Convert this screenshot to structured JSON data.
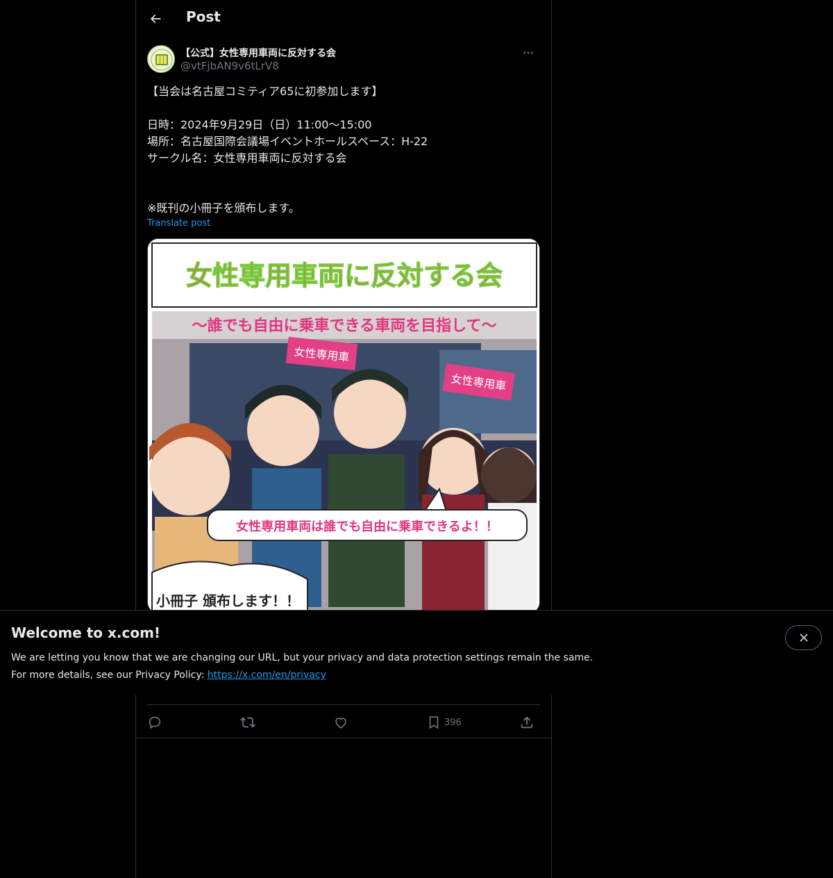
{
  "header": {
    "title": "Post",
    "back_icon": "arrow-left-icon"
  },
  "post": {
    "display_name": "【公式】女性専用車両に反対する会",
    "handle": "@vtFjbAN9v6tLrV8",
    "lines": [
      "【当会は名古屋コミティア65に初参加します】",
      "",
      "日時：2024年9月29日（日）11:00〜15:00",
      "場所：名古屋国際会議場イベントホールスペース：H-22",
      "サークル名：女性専用車両に反対する会",
      "",
      "",
      "※既刊の小冊子を頒布します。"
    ],
    "translate_label": "Translate post",
    "media": {
      "title": "女性専用車両に反対する会",
      "subtitle": "〜誰でも自由に乗車できる車両を目指して〜",
      "sign_1": "女性専用車",
      "sign_2": "女性専用車",
      "speech": "女性専用車両は誰でも自由に乗車できるよ！！",
      "footer": "小冊子 頒布します！！"
    }
  },
  "actions": {
    "reply_icon": "reply-icon",
    "repost_icon": "repost-icon",
    "like_icon": "heart-icon",
    "bookmark_icon": "bookmark-icon",
    "bookmark_count": "396",
    "share_icon": "share-icon"
  },
  "banner": {
    "title": "Welcome to x.com!",
    "line1": "We are letting you know that we are changing our URL, but your privacy and data protection settings remain the same.",
    "line2_prefix": "For more details, see our Privacy Policy: ",
    "link": "https://x.com/en/privacy"
  },
  "colors": {
    "background": "#000000",
    "text": "#e7e9ea",
    "muted": "#71767b",
    "accent": "#1d9bf0",
    "border": "#2f3336",
    "title_pink": "#e2357f"
  }
}
